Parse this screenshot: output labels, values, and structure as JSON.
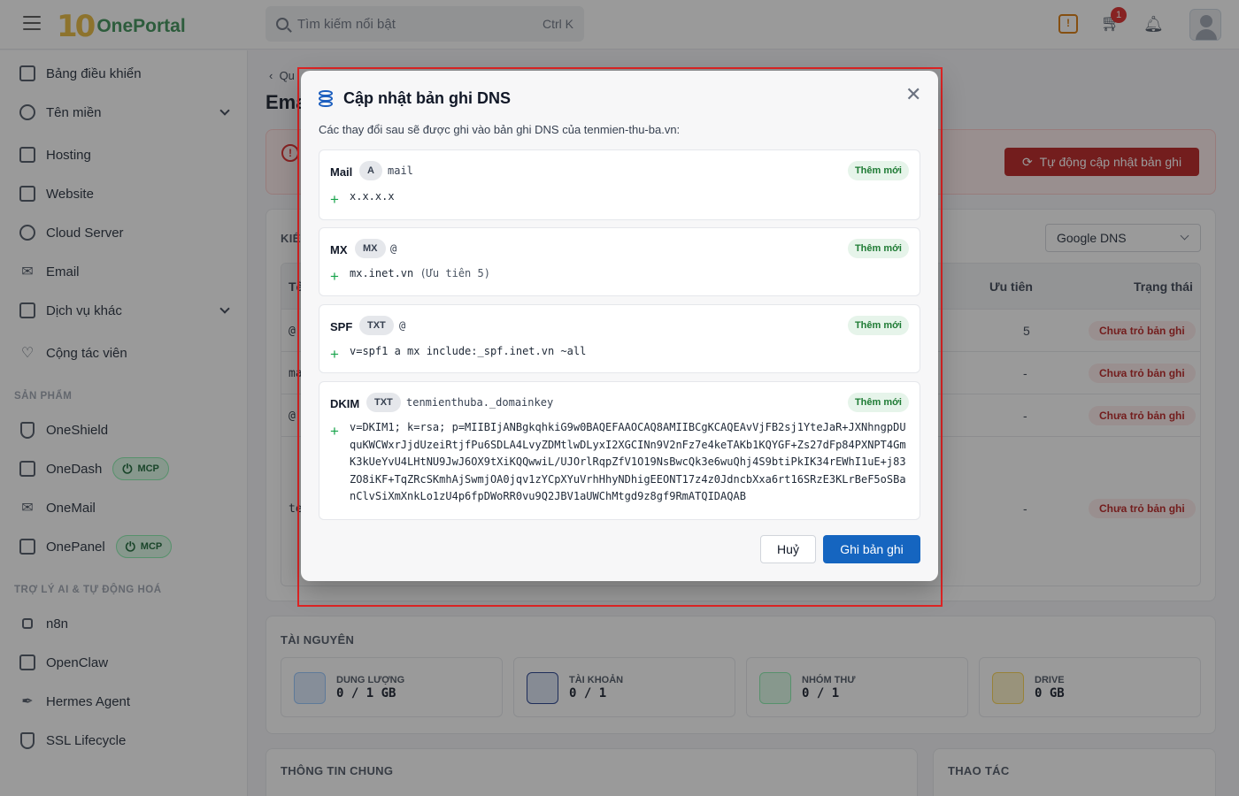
{
  "header": {
    "logo_mark": "10",
    "app_name": "OnePortal",
    "search_placeholder": "Tìm kiếm nổi bật",
    "search_shortcut": "Ctrl K",
    "cart_count": "1"
  },
  "sidebar": {
    "items": [
      {
        "label": "Bảng điều khiển",
        "icon": "dashboard-icon"
      },
      {
        "label": "Tên miền",
        "icon": "globe-icon"
      },
      {
        "label": "Hosting",
        "icon": "server-icon"
      },
      {
        "label": "Website",
        "icon": "website-icon"
      },
      {
        "label": "Cloud Server",
        "icon": "cloud-icon"
      },
      {
        "label": "Email",
        "icon": "mail-icon"
      },
      {
        "label": "Dịch vụ khác",
        "icon": "cubes-icon"
      },
      {
        "label": "Cộng tác viên",
        "icon": "handshake-icon"
      }
    ],
    "products_section": "SẢN PHẨM",
    "products": [
      {
        "label": "OneShield",
        "icon": "shield-icon"
      },
      {
        "label": "OneDash",
        "icon": "dashboard-icon",
        "badge": "MCP"
      },
      {
        "label": "OneMail",
        "icon": "mail-icon"
      },
      {
        "label": "OnePanel",
        "icon": "panel-icon",
        "badge": "MCP"
      }
    ],
    "ai_section": "TRỢ LÝ AI & TỰ ĐỘNG HOÁ",
    "ai_items": [
      {
        "label": "n8n",
        "icon": "workflow-icon"
      },
      {
        "label": "OpenClaw",
        "icon": "robot-icon"
      },
      {
        "label": "Hermes Agent",
        "icon": "feather-icon"
      },
      {
        "label": "SSL Lifecycle",
        "icon": "shield-check-icon"
      }
    ]
  },
  "main": {
    "back_label": "Qu",
    "page_title": "Ema",
    "auto_update_button": "Tự động cập nhật bản ghi",
    "check_label": "KIỂ",
    "dns_provider": "Google DNS",
    "table_headers": {
      "name": "Tê",
      "priority": "Ưu tiên",
      "status": "Trạng thái"
    },
    "rows": [
      {
        "name": "@",
        "priority": "5",
        "status": "Chưa trỏ bản ghi"
      },
      {
        "name": "ma",
        "priority": "-",
        "status": "Chưa trỏ bản ghi"
      },
      {
        "name": "@",
        "priority": "-",
        "status": "Chưa trỏ bản ghi"
      },
      {
        "name": "te",
        "priority": "-",
        "status": "Chưa trỏ bản ghi"
      }
    ],
    "resources_title": "TÀI NGUYÊN",
    "resources": [
      {
        "label": "DUNG LƯỢNG",
        "value": "0 / 1 GB",
        "color": "#dbeafe"
      },
      {
        "label": "TÀI KHOẢN",
        "value": "0 / 1",
        "color": "#dbe4f5"
      },
      {
        "label": "NHÓM THƯ",
        "value": "0 / 1",
        "color": "#dcfce7"
      },
      {
        "label": "DRIVE",
        "value": "0 GB",
        "color": "#fef3c7"
      }
    ],
    "general_title": "THÔNG TIN CHUNG",
    "actions_title": "THAO TÁC"
  },
  "modal": {
    "title": "Cập nhật bản ghi DNS",
    "description": "Các thay đổi sau sẽ được ghi vào bản ghi DNS của tenmien-thu-ba.vn:",
    "records": [
      {
        "name": "Mail",
        "type": "A",
        "host": "mail",
        "badge": "Thêm mới",
        "value": "x.x.x.x",
        "note": ""
      },
      {
        "name": "MX",
        "type": "MX",
        "host": "@",
        "badge": "Thêm mới",
        "value": "mx.inet.vn",
        "note": "(Ưu tiên 5)"
      },
      {
        "name": "SPF",
        "type": "TXT",
        "host": "@",
        "badge": "Thêm mới",
        "value": "v=spf1 a mx include:_spf.inet.vn ~all",
        "note": ""
      },
      {
        "name": "DKIM",
        "type": "TXT",
        "host": "tenmienthuba._domainkey",
        "badge": "Thêm mới",
        "value": "v=DKIM1; k=rsa; p=MIIBIjANBgkqhkiG9w0BAQEFAAOCAQ8AMIIBCgKCAQEAvVjFB2sj1YteJaR+JXNhngpDU\nquKWCWxrJjdUzeiRtjfPu6SDLA4LvyZDMtlwDLyxI2XGCINn9V2nFz7e4keTAKb1KQYGF+Zs27dFp84PXNPT4Gm\nK3kUeYvU4LHtNU9JwJ6OX9tXiKQQwwiL/UJOrlRqpZfV1O19NsBwcQk3e6wuQhj4S9btiPkIK34rEWhI1uE+j83\nZO8iKF+TqZRcSKmhAjSwmjOA0jqv1zYCpXYuVrhHhyNDhigEEONT17z4z0JdncbXxa6rt16SRzE3KLrBeF5oSBa\nnClvSiXmXnkLo1zU4p6fpDWoRR0vu9Q2JBV1aUWChMtgd9z8gf9RmATQIDAQAB",
        "note": ""
      }
    ],
    "cancel_label": "Huỷ",
    "save_label": "Ghi bản ghi"
  }
}
